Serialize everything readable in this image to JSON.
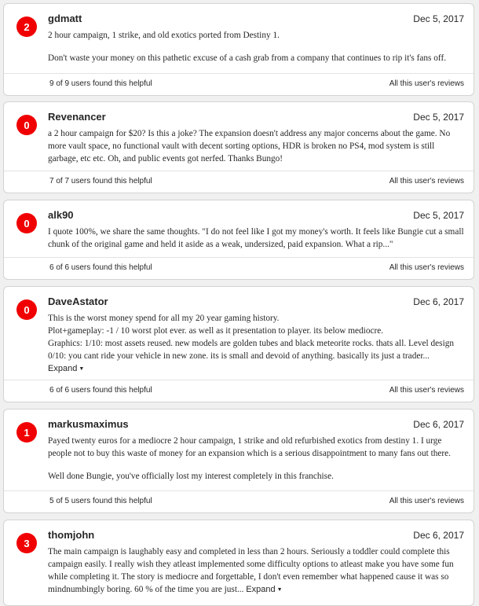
{
  "reviews": [
    {
      "score": "2",
      "author": "gdmatt",
      "date": "Dec 5, 2017",
      "paragraphs": [
        "2 hour campaign, 1 strike, and old exotics ported from Destiny 1.",
        "Don't waste your money on this pathetic excuse of a cash grab from a company that continues to rip it's fans off."
      ],
      "expand_label": "",
      "helpful": "9 of 9 users found this helpful",
      "all_reviews": "All this user's reviews"
    },
    {
      "score": "0",
      "author": "Revenancer",
      "date": "Dec 5, 2017",
      "paragraphs": [
        "a 2 hour campaign for $20? Is this a joke? The expansion doesn't address any major concerns about the game. No more vault space, no functional vault with decent sorting options, HDR is broken no PS4, mod system is still garbage, etc etc. Oh, and public events got nerfed. Thanks Bungo!"
      ],
      "expand_label": "",
      "helpful": "7 of 7 users found this helpful",
      "all_reviews": "All this user's reviews"
    },
    {
      "score": "0",
      "author": "alk90",
      "date": "Dec 5, 2017",
      "paragraphs": [
        "I quote 100%, we share the same thoughts. \"I do not feel like I got my money's worth. It feels like Bungie cut a small chunk of the original game and held it aside as a weak, undersized, paid expansion. What a rip...\""
      ],
      "expand_label": "",
      "helpful": "6 of 6 users found this helpful",
      "all_reviews": "All this user's reviews"
    },
    {
      "score": "0",
      "author": "DaveAstator",
      "date": "Dec 6, 2017",
      "paragraphs": [
        "This is the worst money spend for all my 20 year gaming history.",
        "Plot+gameplay: -1 / 10 worst plot ever. as well as it presentation to player. its below mediocre.",
        "Graphics: 1/10: most assets reused. new models are golden tubes and black meteorite rocks. thats all. Level design 0/10: you cant ride your vehicle in new zone. its is small and devoid of anything. basically its just a trader..."
      ],
      "expand_label": "Expand",
      "helpful": "6 of 6 users found this helpful",
      "all_reviews": "All this user's reviews"
    },
    {
      "score": "1",
      "author": "markusmaximus",
      "date": "Dec 6, 2017",
      "paragraphs": [
        "Payed twenty euros for a mediocre 2 hour campaign, 1 strike and old refurbished exotics from destiny 1. I urge people not to buy this waste of money for an expansion which is a serious disappointment to many fans out there.",
        "Well done Bungie, you've officially lost my interest completely in this franchise."
      ],
      "expand_label": "",
      "helpful": "5 of 5 users found this helpful",
      "all_reviews": "All this user's reviews"
    },
    {
      "score": "3",
      "author": "thomjohn",
      "date": "Dec 6, 2017",
      "paragraphs": [
        "The main campaign is laughably easy and completed in less than 2 hours. Seriously a toddler could complete this campaign easily. I really wish they atleast implemented some difficulty options to atleast make you have some fun while completing it. The story is mediocre and forgettable, I don't even remember what happened cause it was so mindnumbingly boring. 60 % of the time you are just..."
      ],
      "expand_label": "Expand",
      "helpful": "",
      "all_reviews": ""
    }
  ]
}
